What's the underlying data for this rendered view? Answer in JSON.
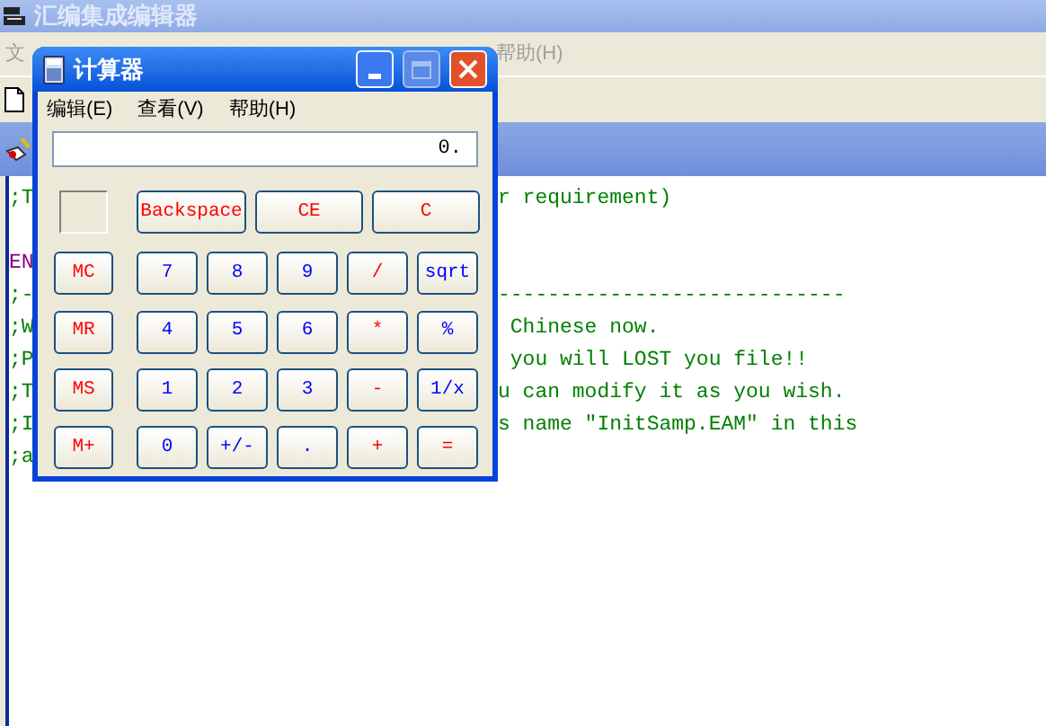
{
  "main_window": {
    "title": "汇编集成编辑器",
    "menu": [
      {
        "label": "文"
      },
      {
        "label": "帮助(H)"
      }
    ]
  },
  "editor": {
    "lines": [
      {
        "kind": "comment",
        "left": ";T",
        "right": "r requirement)"
      },
      {
        "kind": "blank"
      },
      {
        "kind": "keyword",
        "left": "EN"
      },
      {
        "kind": "comment",
        "left": ";-",
        "right": "----------------------------"
      },
      {
        "kind": "comment",
        "left": ";W",
        "right": " Chinese now."
      },
      {
        "kind": "comment",
        "left": ";P",
        "right": " you will LOST you file!!"
      },
      {
        "kind": "comment",
        "left": ";T",
        "right": "u can modify it as you wish."
      },
      {
        "kind": "comment",
        "left": ";I",
        "right": "s name ″InitSamp.EAM″ in this"
      },
      {
        "kind": "comment",
        "left": ";a"
      }
    ]
  },
  "calculator": {
    "title": "计算器",
    "menu": [
      "编辑(E)",
      "查看(V)",
      "帮助(H)"
    ],
    "display": "0.",
    "top_buttons": [
      {
        "label": "Backspace",
        "kind": "red"
      },
      {
        "label": "CE",
        "kind": "red"
      },
      {
        "label": "C",
        "kind": "red"
      }
    ],
    "rows": [
      [
        {
          "label": "MC",
          "kind": "red"
        },
        {
          "label": "7",
          "kind": "blue"
        },
        {
          "label": "8",
          "kind": "blue"
        },
        {
          "label": "9",
          "kind": "blue"
        },
        {
          "label": "/",
          "kind": "red"
        },
        {
          "label": "sqrt",
          "kind": "blue"
        }
      ],
      [
        {
          "label": "MR",
          "kind": "red"
        },
        {
          "label": "4",
          "kind": "blue"
        },
        {
          "label": "5",
          "kind": "blue"
        },
        {
          "label": "6",
          "kind": "blue"
        },
        {
          "label": "*",
          "kind": "red"
        },
        {
          "label": "%",
          "kind": "blue"
        }
      ],
      [
        {
          "label": "MS",
          "kind": "red"
        },
        {
          "label": "1",
          "kind": "blue"
        },
        {
          "label": "2",
          "kind": "blue"
        },
        {
          "label": "3",
          "kind": "blue"
        },
        {
          "label": "-",
          "kind": "red"
        },
        {
          "label": "1/x",
          "kind": "blue"
        }
      ],
      [
        {
          "label": "M+",
          "kind": "red"
        },
        {
          "label": "0",
          "kind": "blue"
        },
        {
          "label": "+/-",
          "kind": "blue"
        },
        {
          "label": ".",
          "kind": "blue"
        },
        {
          "label": "+",
          "kind": "red"
        },
        {
          "label": "=",
          "kind": "red"
        }
      ]
    ]
  }
}
